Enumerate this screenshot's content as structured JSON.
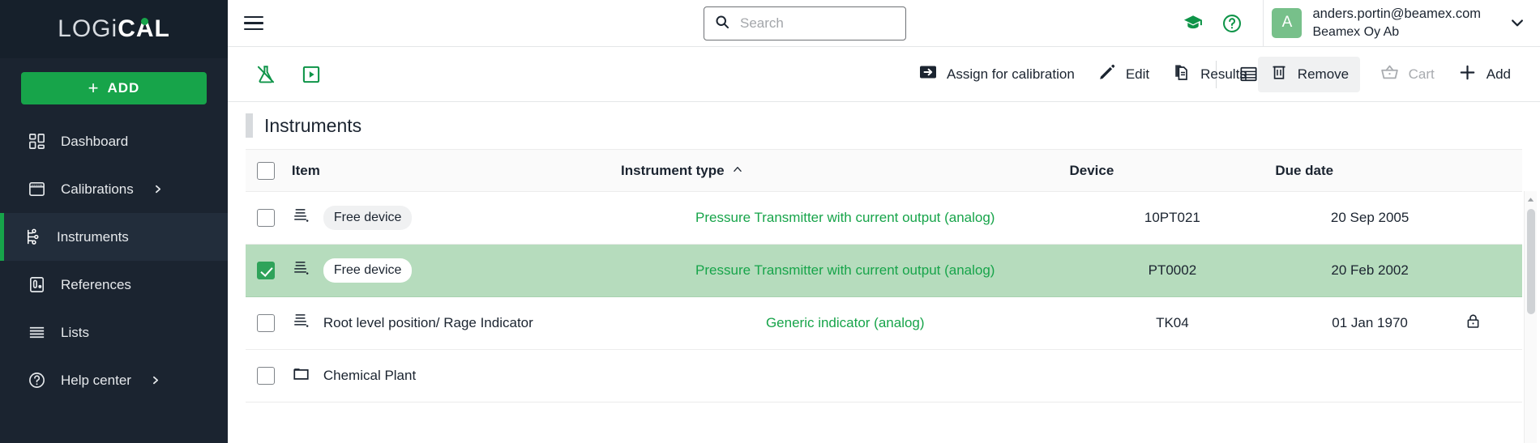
{
  "brand": {
    "light": "LOG",
    "bold": "CAL",
    "dot": "i"
  },
  "sidebar": {
    "add_label": "ADD",
    "add_plus": "+",
    "items": [
      {
        "label": "Dashboard",
        "icon": "dashboard-icon",
        "active": false,
        "chevron": false
      },
      {
        "label": "Calibrations",
        "icon": "calibrations-icon",
        "active": false,
        "chevron": true
      },
      {
        "label": "Instruments",
        "icon": "instruments-icon",
        "active": true,
        "chevron": false
      },
      {
        "label": "References",
        "icon": "references-icon",
        "active": false,
        "chevron": false
      },
      {
        "label": "Lists",
        "icon": "lists-icon",
        "active": false,
        "chevron": false
      },
      {
        "label": "Help center",
        "icon": "help-center-icon",
        "active": false,
        "chevron": true
      }
    ]
  },
  "topbar": {
    "menu_icon": "hamburger-icon",
    "search": {
      "value": "",
      "placeholder": "Search",
      "icon": "search-icon"
    },
    "learning_icon": "graduation-cap-icon",
    "help_icon": "question-circle-icon",
    "user": {
      "avatar_initial": "A",
      "email": "anders.portin@beamex.com",
      "organization": "Beamex Oy Ab",
      "chevron": "chevron-down-icon"
    }
  },
  "toolbar": {
    "left_icons": [
      {
        "name": "flask-disabled-icon"
      },
      {
        "name": "play-box-icon"
      }
    ],
    "actions": [
      {
        "label": "Assign for calibration",
        "icon": "arrow-right-box-icon",
        "hovered": false,
        "disabled": false
      },
      {
        "label": "Edit",
        "icon": "pencil-icon",
        "hovered": false,
        "disabled": false
      },
      {
        "label": "Results",
        "icon": "document-copy-icon",
        "hovered": false,
        "disabled": false
      },
      {
        "label": "Remove",
        "icon": "trash-icon",
        "hovered": true,
        "disabled": false
      }
    ],
    "right_icons": [
      {
        "name": "table-view-icon"
      },
      {
        "name": "tree-view-icon"
      },
      {
        "name": "filter-icon"
      }
    ],
    "cart": {
      "label": "Cart",
      "icon": "cart-icon",
      "disabled": true
    },
    "add": {
      "label": "Add",
      "icon": "plus-icon",
      "disabled": false
    }
  },
  "page": {
    "title": "Instruments"
  },
  "table": {
    "select_all_checked": false,
    "columns": [
      {
        "key": "check",
        "label": ""
      },
      {
        "key": "item",
        "label": "Item"
      },
      {
        "key": "type",
        "label": "Instrument type",
        "sort": "asc",
        "sort_icon": "caret-up-icon"
      },
      {
        "key": "device",
        "label": "Device"
      },
      {
        "key": "due",
        "label": "Due date"
      }
    ],
    "rows": [
      {
        "checked": false,
        "icon": "instrument-icon",
        "item": "Free device",
        "item_is_badge": true,
        "type": "Pressure Transmitter with current output (analog)",
        "device": "10PT021",
        "due": "20 Sep 2005",
        "locked": false,
        "selected": false
      },
      {
        "checked": true,
        "icon": "instrument-icon",
        "item": "Free device",
        "item_is_badge": true,
        "type": "Pressure Transmitter with current output (analog)",
        "device": "PT0002",
        "due": "20 Feb 2002",
        "locked": false,
        "selected": true
      },
      {
        "checked": false,
        "icon": "instrument-icon",
        "item": "Root level position/ Rage Indicator",
        "item_is_badge": false,
        "type": "Generic indicator (analog)",
        "device": "TK04",
        "due": "01 Jan 1970",
        "locked": true,
        "lock_icon": "lock-icon",
        "selected": false
      },
      {
        "checked": false,
        "icon": "folder-icon",
        "item": "Chemical Plant",
        "item_is_badge": false,
        "type": "",
        "device": "",
        "due": "",
        "locked": false,
        "selected": false
      }
    ]
  },
  "colors": {
    "brand_green": "#17a44a",
    "sidebar_bg": "#1b2430",
    "selected_row": "#b6dcbd",
    "link_green": "#17a44a",
    "avatar_green": "#77c08a"
  }
}
